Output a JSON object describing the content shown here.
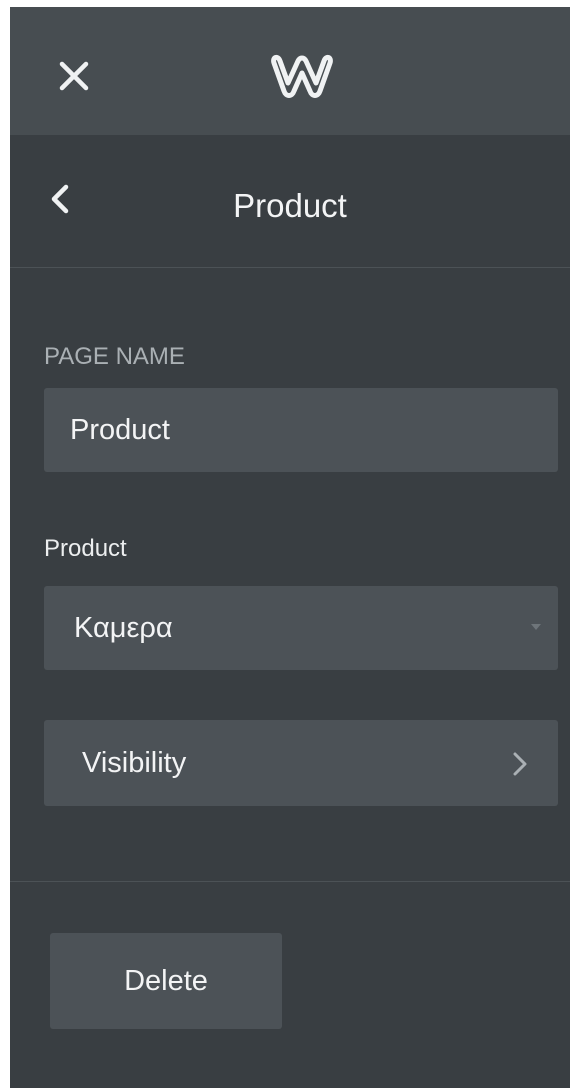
{
  "top_bar": {
    "close_icon": "close-icon",
    "logo_icon": "weebly-logo-icon"
  },
  "header": {
    "back_icon": "chevron-left-icon",
    "title": "Product"
  },
  "page_name": {
    "label": "PAGE NAME",
    "value": "Product"
  },
  "product": {
    "label": "Product",
    "selected": "Καμερα",
    "caret_icon": "caret-down-icon"
  },
  "visibility": {
    "label": "Visibility",
    "chevron_icon": "chevron-right-icon"
  },
  "actions": {
    "delete_label": "Delete"
  },
  "colors": {
    "panel_bg": "#393e42",
    "top_bar_bg": "#474d51",
    "control_bg": "#4c5257",
    "text": "#f3f4f5",
    "muted_text": "#aab0b4"
  }
}
